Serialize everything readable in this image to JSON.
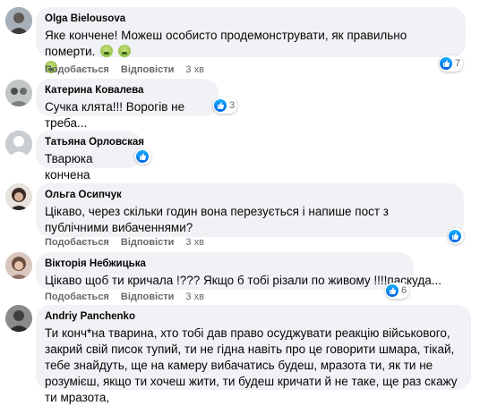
{
  "actions": {
    "like": "Подобається",
    "reply": "Відповісти"
  },
  "comments": [
    {
      "author": "Olga Bielousova",
      "text": "Яке кончене! Можеш особисто продемонструвати, як правильно померти.",
      "emoji": "sick-face",
      "time": "3 хв",
      "reactions": "7",
      "avatar_color": "#8e9aa5"
    },
    {
      "author": "Катерина Ковалева",
      "text": "Сучка клята!!! Ворогів не треба...",
      "time": "",
      "reactions": "3",
      "avatar_color": "#9aa3a0"
    },
    {
      "author": "Татьяна Орловская",
      "text": "Тварюка кончена",
      "time": "",
      "reactions": "",
      "avatar_color": "#c9ccd1"
    },
    {
      "author": "Ольга Осипчук",
      "text": "Цікаво, через скільки годин вона перезується і напише пост з публічними вибаченнями?",
      "time": "3 хв",
      "reactions": "",
      "avatar_color": "#5d4a3f"
    },
    {
      "author": "Вікторія Небжицька",
      "text": "Цікаво щоб ти кричала !??? Якщо б тобі різали по живому !!!!паскуда...",
      "time": "3 хв",
      "reactions": "6",
      "avatar_color": "#b89a8a"
    },
    {
      "author": "Andriy Panchenko",
      "text": "Ти конч*на тварина, хто тобі дав право осуджувати реакцію військового, закрий свій писок тупий, ти не гідна навіть про це говорити шмара, тікай, тебе знайдуть, ще на камеру вибачатись будеш, мразота ти, як ти не розумієш, якщо ти хочеш жити, ти будеш кричати й не таке, ще раз скажу ти мразота,",
      "time": "",
      "reactions": "",
      "avatar_color": "#6f6f6f"
    }
  ],
  "colors": {
    "bubble": "#f0f2f5",
    "meta": "#65676b",
    "like_blue": "#1877f2"
  }
}
